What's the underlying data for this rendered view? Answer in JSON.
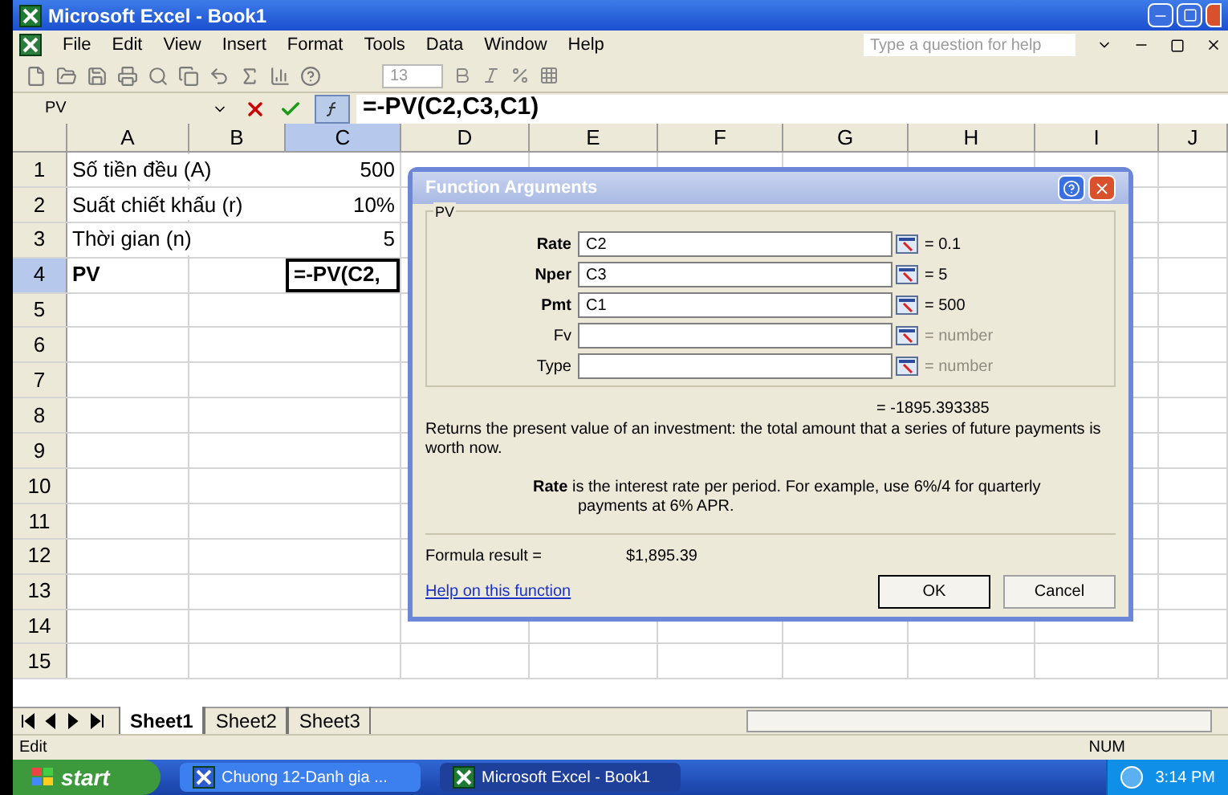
{
  "window": {
    "title": "Microsoft Excel - Book1"
  },
  "menu": [
    "File",
    "Edit",
    "View",
    "Insert",
    "Format",
    "Tools",
    "Data",
    "Window",
    "Help"
  ],
  "help_box": {
    "placeholder": "Type a question for help"
  },
  "toolbar": {
    "font_size": "13"
  },
  "formula_bar": {
    "name_box": "PV",
    "formula": "=-PV(C2,C3,C1)"
  },
  "sheet": {
    "columns": [
      {
        "label": "A",
        "selected": false
      },
      {
        "label": "B",
        "selected": false
      },
      {
        "label": "C",
        "selected": true
      },
      {
        "label": "D",
        "selected": false
      },
      {
        "label": "E",
        "selected": false
      },
      {
        "label": "F",
        "selected": false
      },
      {
        "label": "G",
        "selected": false
      },
      {
        "label": "H",
        "selected": false
      },
      {
        "label": "I",
        "selected": false
      },
      {
        "label": "J",
        "selected": false
      }
    ],
    "rows": [
      {
        "label": "1",
        "selected": false,
        "a": "Số tiền đều (A)",
        "a_bold": false,
        "c": "500",
        "c_active": false
      },
      {
        "label": "2",
        "selected": false,
        "a": "Suất chiết khấu (r)",
        "a_bold": false,
        "c": "10%",
        "c_active": false
      },
      {
        "label": "3",
        "selected": false,
        "a": "Thời gian (n)",
        "a_bold": false,
        "c": "5",
        "c_active": false
      },
      {
        "label": "4",
        "selected": true,
        "a": "PV",
        "a_bold": true,
        "c": "=-PV(C2,",
        "c_active": true
      },
      {
        "label": "5",
        "selected": false
      },
      {
        "label": "6",
        "selected": false
      },
      {
        "label": "7",
        "selected": false
      },
      {
        "label": "8",
        "selected": false
      },
      {
        "label": "9",
        "selected": false
      },
      {
        "label": "10",
        "selected": false
      },
      {
        "label": "11",
        "selected": false
      },
      {
        "label": "12",
        "selected": false
      },
      {
        "label": "13",
        "selected": false
      },
      {
        "label": "14",
        "selected": false
      },
      {
        "label": "15",
        "selected": false
      }
    ]
  },
  "dialog": {
    "title": "Function Arguments",
    "group": "PV",
    "arguments": [
      {
        "name": "Rate",
        "required": true,
        "value": "C2",
        "result": "= 0.1",
        "result_dimmed": false
      },
      {
        "name": "Nper",
        "required": true,
        "value": "C3",
        "result": "= 5",
        "result_dimmed": false
      },
      {
        "name": "Pmt",
        "required": true,
        "value": "C1",
        "result": "= 500",
        "result_dimmed": false
      },
      {
        "name": "Fv",
        "required": false,
        "result": "= number",
        "result_dimmed": true
      },
      {
        "name": "Type",
        "required": false,
        "result": "= number",
        "result_dimmed": true
      }
    ],
    "total": "= -1895.393385",
    "description": "Returns the present value of an investment: the total amount that a series of future payments is worth now.",
    "argument_help": "**Rate** is the interest rate per period. For example, use 6%/4 for quarterly payments at 6% APR.",
    "formula_result_label": "Formula result =",
    "formula_result": "$1,895.39",
    "help_link": "Help on this function",
    "buttons": [
      {
        "label": "OK",
        "selected": true
      },
      {
        "label": "Cancel",
        "selected": false
      }
    ]
  },
  "sheet_tabs": [
    {
      "label": "Sheet1",
      "selected": true
    },
    {
      "label": "Sheet2",
      "selected": false
    },
    {
      "label": "Sheet3",
      "selected": false
    }
  ],
  "status_bar": {
    "mode": "Edit",
    "num": "NUM"
  },
  "taskbar": {
    "start": "start",
    "tasks": [
      {
        "label": "Chuong 12-Danh gia ...",
        "kind": "word",
        "selected": false
      },
      {
        "label": "Microsoft Excel - Book1",
        "kind": "excel",
        "selected": true
      }
    ],
    "clock": "3:14 PM"
  }
}
